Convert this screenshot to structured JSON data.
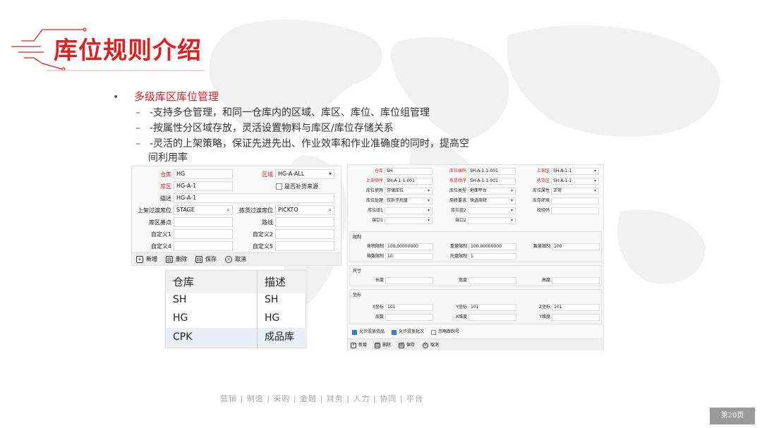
{
  "slide": {
    "title": "库位规则介绍",
    "bullet": "•",
    "heading": "多级库区库位管理",
    "dash": "–",
    "points": [
      "-支持多仓管理，和同一仓库内的区域、库区、库位、库位组管理",
      "-按属性分区域存放，灵活设置物料与库区/库位存储关系",
      "-灵活的上架策略，保证先进先出、作业效率和作业准确度的同时，提高空"
    ],
    "point3_cont": "间利用率",
    "footer": "营销   |   制造   |   采购   |   金融   |   财务   |   人力   |   协同   |   平台",
    "page": "第20页"
  },
  "left_form": {
    "warehouse_label": "仓库",
    "warehouse_value": "HG",
    "area_label": "区域",
    "area_value": "HG-A-ALL",
    "zone_label": "库区",
    "zone_value": "HG-A-1",
    "replenish_label": "是否补货来源",
    "desc_label": "描述",
    "desc_value": "HG-A-1",
    "putaway_label": "上架过渡库位",
    "putaway_value": "STAGE",
    "pick_label": "拣货过渡库位",
    "pick_value": "PICKTO",
    "base_label": "库区基点",
    "route_label": "路线",
    "c1_label": "自定义1",
    "c2_label": "自定义2",
    "c4_label": "自定义4",
    "c5_label": "自定义5"
  },
  "toolbar": {
    "new": "新增",
    "delete": "删除",
    "save": "保存",
    "cancel": "取消"
  },
  "warehouse_table": {
    "headers": [
      "仓库",
      "描述"
    ],
    "rows": [
      [
        "SH",
        "SH"
      ],
      [
        "HG",
        "HG"
      ],
      [
        "CPK",
        "成品库"
      ]
    ]
  },
  "right_form": {
    "wh_label": "仓库",
    "wh_value": "SH",
    "loc_code_label": "库位编码",
    "loc_code_value": "SH-A-1-1-001",
    "zone_label": "上架区",
    "zone_value": "SH-A-1-1",
    "put_seq_label": "上架顺序",
    "put_seq_value": "SH-A-1-1-001",
    "pick_seq_label": "拣货顺序",
    "pick_seq_value": "SH-A-1-1-001",
    "pick_zone_label": "拣货区",
    "pick_zone_value": "SH-A-1-1",
    "use_label": "库位使用",
    "use_value": "存储库位",
    "type_label": "库位类型",
    "type_value": "地面平台",
    "attr_label": "库位属性",
    "attr_value": "正常",
    "handle_label": "库位处理",
    "handle_value": "仅拆于托盘",
    "turn_label": "周转要求",
    "turn_value": "快进周转",
    "env_label": "库存环境",
    "grp1_label": "库位组1",
    "grp2_label": "库位组2",
    "check_label": "校验码",
    "port1_label": "端口1",
    "port2_label": "端口2",
    "limit_title": "限制",
    "vol_label": "体积限制",
    "vol_value": "100.00000000",
    "wt_label": "重量限制",
    "wt_value": "100.00000000",
    "qty_label": "数量限制",
    "qty_value": "100",
    "box_label": "箱数限制",
    "box_value": "10",
    "pal_label": "托盘限制",
    "pal_value": "1",
    "size_title": "尺寸",
    "len_label": "长度",
    "wid_label": "宽度",
    "hgt_label": "高度",
    "coord_title": "坐标",
    "x_label": "X坐标",
    "x_value": "101",
    "y_label": "Y坐标",
    "y_value": "101",
    "z_label": "Z坐标",
    "z_value": "101",
    "layer_label": "层数",
    "xw_label": "X维度",
    "yw_label": "Y维度",
    "opt1": "允许混放货品",
    "opt2": "允许混放批次",
    "opt3": "忽略跟踪号"
  }
}
